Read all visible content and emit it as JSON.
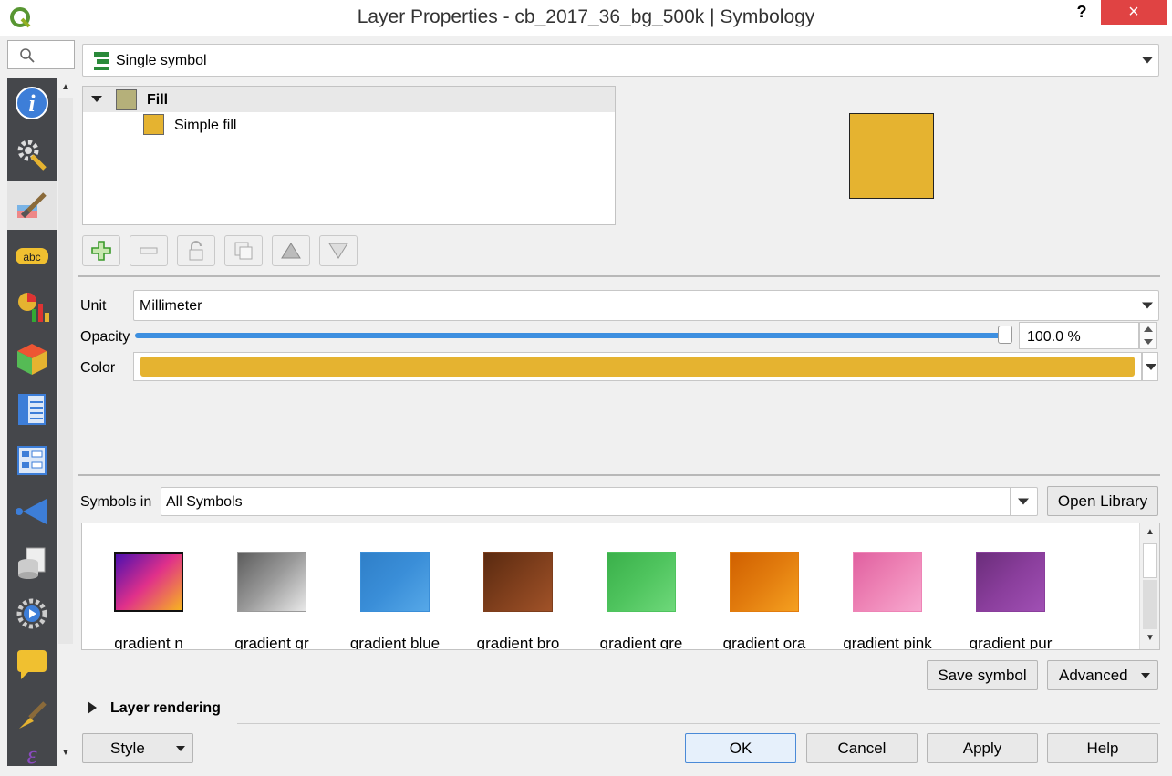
{
  "window": {
    "title": "Layer Properties - cb_2017_36_bg_500k | Symbology",
    "help_label": "?",
    "close_label": "×"
  },
  "nav": {
    "search_placeholder": "",
    "items": [
      {
        "name": "information",
        "icon": "info-icon"
      },
      {
        "name": "source",
        "icon": "gear-tools-icon"
      },
      {
        "name": "symbology",
        "icon": "paintbrush-icon",
        "active": true
      },
      {
        "name": "labels",
        "icon": "abc-label-icon"
      },
      {
        "name": "diagrams",
        "icon": "diagram-icon"
      },
      {
        "name": "3d-view",
        "icon": "cube-icon"
      },
      {
        "name": "fields",
        "icon": "fields-table-icon"
      },
      {
        "name": "attributes-form",
        "icon": "form-icon"
      },
      {
        "name": "joins",
        "icon": "join-icon"
      },
      {
        "name": "auxiliary-storage",
        "icon": "storage-icon"
      },
      {
        "name": "actions",
        "icon": "actions-icon"
      },
      {
        "name": "display",
        "icon": "speech-bubble-icon"
      },
      {
        "name": "rendering",
        "icon": "brush-icon"
      },
      {
        "name": "variables",
        "icon": "variables-icon"
      }
    ]
  },
  "renderer": {
    "selected": "Single symbol",
    "icon": "single-symbol-icon"
  },
  "symbol_tree": {
    "root_label": "Fill",
    "root_color": "#b5b07a",
    "child_label": "Simple fill",
    "child_color": "#e5b330"
  },
  "preview_color": "#e5b330",
  "layer_buttons": [
    {
      "name": "add-layer",
      "icon": "plus-icon"
    },
    {
      "name": "remove-layer",
      "icon": "minus-icon"
    },
    {
      "name": "lock-layer",
      "icon": "lock-icon"
    },
    {
      "name": "duplicate-layer",
      "icon": "duplicate-icon"
    },
    {
      "name": "move-up",
      "icon": "triangle-up-icon"
    },
    {
      "name": "move-down",
      "icon": "triangle-down-icon"
    }
  ],
  "props": {
    "unit_label": "Unit",
    "unit_value": "Millimeter",
    "opacity_label": "Opacity",
    "opacity_value": "100.0 %",
    "opacity_fraction": 1.0,
    "color_label": "Color",
    "color_value": "#e5b330"
  },
  "symbols": {
    "label": "Symbols in",
    "group_value": "All Symbols",
    "open_library_label": "Open Library",
    "items": [
      {
        "label": "gradient  n",
        "from": "#4a0fb0",
        "to": "#f7b320",
        "mid": "#e0308a"
      },
      {
        "label": "gradient  gr",
        "from": "#5c5c5c",
        "to": "#e8e8e8",
        "mid": "#9a9a9a"
      },
      {
        "label": "gradient blue",
        "from": "#2f7fc8",
        "to": "#56a8e8",
        "mid": "#3a8ed8"
      },
      {
        "label": "gradient bro",
        "from": "#5a2a10",
        "to": "#a05228",
        "mid": "#7e3e1c"
      },
      {
        "label": "gradient gre",
        "from": "#3ab04a",
        "to": "#6ed87a",
        "mid": "#4fc45e"
      },
      {
        "label": "gradient ora",
        "from": "#d06000",
        "to": "#f5a020",
        "mid": "#e27c0e"
      },
      {
        "label": "gradient pink",
        "from": "#e060a0",
        "to": "#f7a8cf",
        "mid": "#ee84b6"
      },
      {
        "label": "gradient pur",
        "from": "#6a2d7a",
        "to": "#a050b4",
        "mid": "#8a3e9c"
      }
    ],
    "save_symbol_label": "Save symbol",
    "advanced_label": "Advanced"
  },
  "layer_rendering_label": "Layer rendering",
  "footer": {
    "style_label": "Style",
    "ok_label": "OK",
    "cancel_label": "Cancel",
    "apply_label": "Apply",
    "help_label": "Help"
  }
}
